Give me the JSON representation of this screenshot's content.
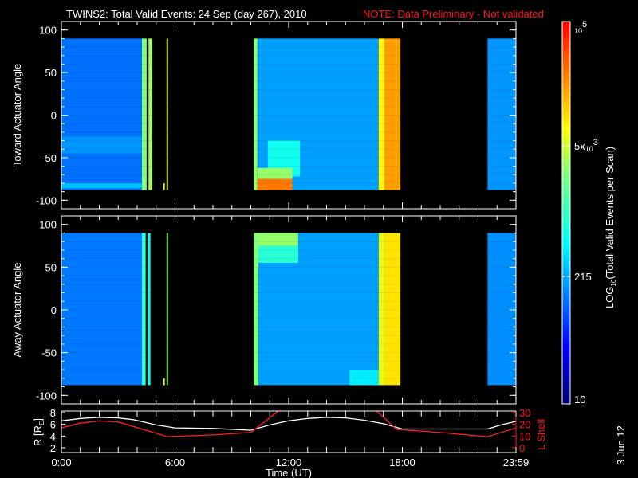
{
  "title": {
    "main": "TWINS2: Total Valid Events: 24 Sep (day 267), 2010",
    "note": "NOTE: Data Preliminary - Not validated"
  },
  "stamp": "3 Jun 12",
  "colors": {
    "note": "#ff1a1a",
    "lshell": "#ff2020",
    "radius": "#ffffff"
  },
  "chart_data": [
    {
      "type": "heatmap",
      "panel": "toward",
      "ylabel": "Toward Actuator Angle",
      "ylim": [
        -110,
        110
      ],
      "yticks": [
        "100",
        "50",
        "0",
        "-50",
        "-100"
      ],
      "ytick_values": [
        100,
        50,
        0,
        -50,
        -100
      ],
      "xlim_hours": [
        0,
        24
      ],
      "blocks": [
        {
          "t": [
            0,
            4.25
          ],
          "a": [
            -88,
            90
          ],
          "v": 120
        },
        {
          "t": [
            0,
            4.25
          ],
          "a": [
            -45,
            -25
          ],
          "v": 170
        },
        {
          "t": [
            0,
            4.25
          ],
          "a": [
            -86,
            -80
          ],
          "v": 260
        },
        {
          "t": [
            4.25,
            4.5
          ],
          "a": [
            -88,
            90
          ],
          "v": 2500
        },
        {
          "t": [
            4.6,
            4.8
          ],
          "a": [
            -88,
            90
          ],
          "v": 3200
        },
        {
          "t": [
            5.55,
            5.63
          ],
          "a": [
            -88,
            90
          ],
          "v": 6500
        },
        {
          "t": [
            5.38,
            5.46
          ],
          "a": [
            -88,
            -80
          ],
          "v": 6500
        },
        {
          "t": [
            10.15,
            10.35
          ],
          "a": [
            -88,
            90
          ],
          "v": 3000
        },
        {
          "t": [
            10.35,
            16.75
          ],
          "a": [
            -88,
            90
          ],
          "v": 190
        },
        {
          "t": [
            10.9,
            12.6
          ],
          "a": [
            -72,
            -30
          ],
          "v": 600
        },
        {
          "t": [
            10.35,
            12.2
          ],
          "a": [
            -75,
            -62
          ],
          "v": 3000
        },
        {
          "t": [
            10.35,
            12.2
          ],
          "a": [
            -88,
            -75
          ],
          "v": 30000
        },
        {
          "t": [
            16.75,
            17.05
          ],
          "a": [
            -88,
            90
          ],
          "v": 8000
        },
        {
          "t": [
            17.05,
            17.9
          ],
          "a": [
            -88,
            90
          ],
          "v": 20000
        },
        {
          "t": [
            22.5,
            24
          ],
          "a": [
            -88,
            90
          ],
          "v": 170
        }
      ]
    },
    {
      "type": "heatmap",
      "panel": "away",
      "ylabel": "Away Actuator Angle",
      "ylim": [
        -110,
        110
      ],
      "yticks": [
        "100",
        "50",
        "0",
        "-50",
        "-100"
      ],
      "ytick_values": [
        100,
        50,
        0,
        -50,
        -100
      ],
      "xlim_hours": [
        0,
        24
      ],
      "blocks": [
        {
          "t": [
            0,
            4.25
          ],
          "a": [
            -88,
            90
          ],
          "v": 130
        },
        {
          "t": [
            4.25,
            4.45
          ],
          "a": [
            -88,
            90
          ],
          "v": 800
        },
        {
          "t": [
            4.55,
            4.7
          ],
          "a": [
            -88,
            90
          ],
          "v": 600
        },
        {
          "t": [
            5.55,
            5.63
          ],
          "a": [
            -88,
            90
          ],
          "v": 3000
        },
        {
          "t": [
            5.38,
            5.46
          ],
          "a": [
            -88,
            -80
          ],
          "v": 5000
        },
        {
          "t": [
            10.15,
            10.4
          ],
          "a": [
            -88,
            90
          ],
          "v": 2500
        },
        {
          "t": [
            10.4,
            16.75
          ],
          "a": [
            -88,
            90
          ],
          "v": 190
        },
        {
          "t": [
            10.4,
            12.5
          ],
          "a": [
            55,
            75
          ],
          "v": 800
        },
        {
          "t": [
            10.4,
            12.5
          ],
          "a": [
            75,
            90
          ],
          "v": 3000
        },
        {
          "t": [
            15.2,
            16.75
          ],
          "a": [
            -88,
            -70
          ],
          "v": 400
        },
        {
          "t": [
            16.75,
            17.05
          ],
          "a": [
            -88,
            90
          ],
          "v": 6000
        },
        {
          "t": [
            17.05,
            17.9
          ],
          "a": [
            -88,
            90
          ],
          "v": 10000
        },
        {
          "t": [
            22.5,
            24
          ],
          "a": [
            -88,
            90
          ],
          "v": 160
        }
      ]
    },
    {
      "type": "line",
      "panel": "orbit",
      "ylabel": "R [R",
      "ylabel_sub": "E",
      "ylabel_end": "]",
      "ylim": [
        2,
        8
      ],
      "yticks": [
        "8",
        "6",
        "4",
        "2"
      ],
      "ytick_values": [
        8,
        6,
        4,
        2
      ],
      "y2label": "L Shell",
      "y2lim": [
        0,
        30
      ],
      "y2ticks": [
        "30",
        "20",
        "10",
        "0"
      ],
      "y2tick_values": [
        30,
        20,
        10,
        0
      ],
      "xlabel": "Time (UT)",
      "xticks": [
        "0:00",
        "6:00",
        "12:00",
        "18:00",
        "23:59"
      ],
      "xtick_values": [
        0,
        6,
        12,
        18,
        24
      ],
      "series": [
        {
          "name": "R",
          "axis": "left",
          "x": [
            0,
            1,
            2,
            3,
            3.8,
            5,
            6,
            8,
            10,
            11,
            12,
            13,
            14,
            15,
            16,
            17,
            18,
            20,
            22.5,
            23.2,
            24
          ],
          "y": [
            6.6,
            7.0,
            7.2,
            7.1,
            6.8,
            5.9,
            5.4,
            5.3,
            5.0,
            5.9,
            6.6,
            7.0,
            7.2,
            7.1,
            6.7,
            6.1,
            5.2,
            5.2,
            5.2,
            5.9,
            6.5
          ]
        },
        {
          "name": "L Shell",
          "axis": "right",
          "x": [
            0,
            1,
            2,
            3,
            5.6,
            8,
            10,
            11.5,
            null,
            16.6,
            17.7,
            20,
            22.5,
            24
          ],
          "y": [
            17,
            21,
            23,
            22,
            9.5,
            11,
            13,
            32,
            null,
            32,
            15.7,
            13,
            9.5,
            17
          ]
        }
      ]
    }
  ],
  "colorbar": {
    "label_pre": "LOG",
    "label_sub": "10",
    "label_post": "(Total Valid Events per Scan)",
    "range": [
      10,
      100000
    ],
    "ticks": [
      {
        "value": 100000,
        "base": "10",
        "exp": "5",
        "prefix": ""
      },
      {
        "value": 5000,
        "base": "10",
        "exp": "3",
        "prefix": "5x"
      },
      {
        "value": 215,
        "text": "215"
      },
      {
        "value": 10,
        "text": "10"
      }
    ]
  }
}
